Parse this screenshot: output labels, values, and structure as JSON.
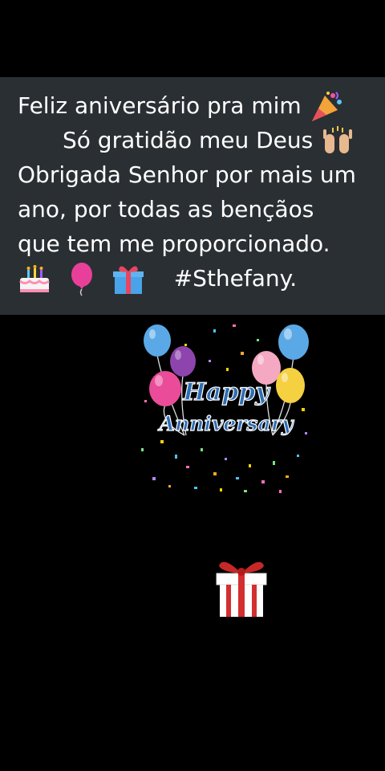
{
  "caption": {
    "line1": "Feliz aniversário pra mim",
    "line2": "Só gratidão meu Deus",
    "line3": "Obrigada Senhor por mais um",
    "line4": "ano, por todas as bençãos",
    "line5": "que tem me proporcionado.",
    "hashtag": "#Sthefany."
  },
  "card": {
    "word1": "Happy",
    "word2": "Anniversary"
  },
  "icons": [
    "party-popper-icon",
    "raised-hands-icon",
    "birthday-cake-icon",
    "balloon-icon",
    "gift-icon",
    "gift-box-icon"
  ],
  "colors": {
    "caption_bg": "#2a2f33",
    "text": "#ffffff",
    "card_text": "#2f6db3"
  }
}
